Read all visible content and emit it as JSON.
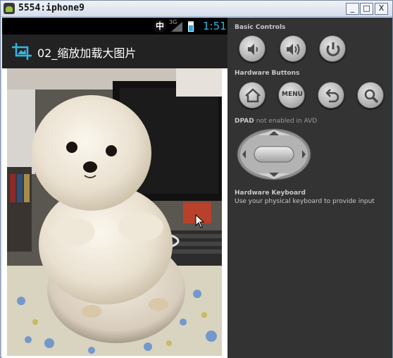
{
  "window": {
    "title": "5554:iphone9",
    "minimize_label": "_",
    "maximize_label": "□",
    "close_label": "X"
  },
  "statusbar": {
    "ime_label": "中",
    "network_label": "3G",
    "time": "1:51"
  },
  "actionbar": {
    "title": "02_缩放加载大图片"
  },
  "controls": {
    "basic_label": "Basic Controls",
    "hardware_buttons_label": "Hardware Buttons",
    "menu_label": "MENU",
    "dpad_label": "DPAD",
    "dpad_note": "not enabled in AVD",
    "keyboard_title": "Hardware Keyboard",
    "keyboard_hint": "Use your physical keyboard to provide input"
  }
}
